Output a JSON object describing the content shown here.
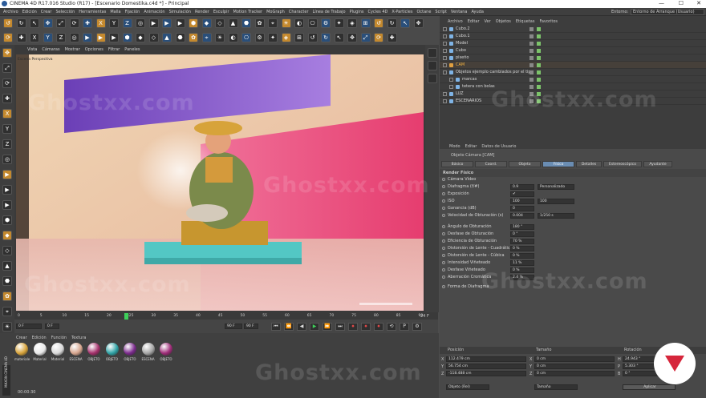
{
  "window": {
    "title": "CINEMA 4D R17.016 Studio (R17) - [Escenario Domestika.c4d *] - Principal",
    "controls": [
      "—",
      "☐",
      "✕"
    ]
  },
  "menu": {
    "items": [
      "Archivo",
      "Edición",
      "Crear",
      "Selección",
      "Herramientas",
      "Malla",
      "Fijación",
      "Animación",
      "Simulación",
      "Render",
      "Esculpir",
      "Motion Tracker",
      "MoGraph",
      "Character",
      "Línea de Trabajo",
      "Plugins",
      "Cycles 4D",
      "X-Particles",
      "Octane",
      "Script",
      "Ventana",
      "Ayuda"
    ],
    "layout_label": "Entorno:",
    "layout_value": "Entorno de Arranque (Usuario)"
  },
  "viewport": {
    "menu": [
      "Vista",
      "Cámaras",
      "Mostrar",
      "Opciones",
      "Filtrar",
      "Paneles"
    ],
    "caption": "Escena Perspectiva"
  },
  "objects": {
    "menu": [
      "Archivo",
      "Editar",
      "Ver",
      "Objetos",
      "Etiquetas",
      "Favoritos"
    ],
    "items": [
      {
        "name": "Cubo.2",
        "indent": 0
      },
      {
        "name": "Cubo.1",
        "indent": 0
      },
      {
        "name": "Model",
        "indent": 0
      },
      {
        "name": "Cubo",
        "indent": 0
      },
      {
        "name": "piseño",
        "indent": 0
      },
      {
        "name": "CAM",
        "indent": 0
      },
      {
        "name": "Objetos ejemplo cambiados por el tipo",
        "indent": 0
      },
      {
        "name": "marcas",
        "indent": 1
      },
      {
        "name": "tetera con bolas",
        "indent": 1
      },
      {
        "name": "LUZ",
        "indent": 0
      },
      {
        "name": "ESCENARIOS",
        "indent": 0
      }
    ]
  },
  "attributes": {
    "menu": [
      "Modo",
      "Editar",
      "Datos de Usuario"
    ],
    "object_title": "Objeto Cámara [CAM]",
    "tabs": [
      "Básico",
      "Coord.",
      "Objeto",
      "Físico",
      "Detalles",
      "Estereoscópico",
      "Ayudante"
    ],
    "active_tab": "Físico",
    "section": "Render Físico",
    "rows": [
      {
        "label": "Cámara Vídeo",
        "value": ""
      },
      {
        "label": "Diafragma (f/#)",
        "value": "0.9",
        "extra": "Personalizado"
      },
      {
        "label": "Exposición",
        "value": "✔"
      },
      {
        "label": "ISO",
        "value": "100",
        "extra": "100"
      },
      {
        "label": "Ganancia (dB)",
        "value": "0"
      },
      {
        "label": "Velocidad de Obturación (s)",
        "value": "0.004",
        "extra": "1/250 s"
      },
      {
        "label": "Ángulo de Obturación",
        "value": "180 °"
      },
      {
        "label": "Desfase de Obturación",
        "value": "0 °"
      },
      {
        "label": "Eficiencia de Obturación",
        "value": "70 %"
      },
      {
        "label": "Distorsión de Lente - Cuadrática",
        "value": "0 %"
      },
      {
        "label": "Distorsión de Lente - Cúbica",
        "value": "0 %"
      },
      {
        "label": "Intensidad Viñeteado",
        "value": "11 %"
      },
      {
        "label": "Desfase Viñeteado",
        "value": "0 %"
      },
      {
        "label": "Aberración Cromática",
        "value": "2.4 %"
      },
      {
        "label": "Forma de Diafragma",
        "value": ""
      }
    ]
  },
  "coords": {
    "headers": [
      "Posición",
      "Tamaño",
      "Rotación"
    ],
    "rows": [
      {
        "axis": "X",
        "pos": "112.479 cm",
        "size": "0 cm",
        "rot_axis": "H",
        "rot": "24.943 °"
      },
      {
        "axis": "Y",
        "pos": "56.754 cm",
        "size": "0 cm",
        "rot_axis": "P",
        "rot": "5.303 °"
      },
      {
        "axis": "Z",
        "pos": "-118.488 cm",
        "size": "0 cm",
        "rot_axis": "B",
        "rot": "0 °"
      }
    ],
    "mode": "Objeto (Rel)",
    "size_mode": "Tamaño",
    "apply": "Aplicar"
  },
  "timeline": {
    "ticks": [
      "0",
      "5",
      "10",
      "15",
      "20",
      "24",
      "25",
      "30",
      "35",
      "40",
      "45",
      "50",
      "55",
      "60",
      "65",
      "70",
      "75",
      "80",
      "85",
      "90"
    ],
    "start": "0 F",
    "current": "0 F",
    "end": "90 F",
    "end2": "90 F",
    "fps": "24 F"
  },
  "materials": {
    "menu": [
      "Crear",
      "Edición",
      "Función",
      "Textura"
    ],
    "items": [
      {
        "label": "materiale",
        "color": "#d7a33a"
      },
      {
        "label": "Material",
        "color": "#e8e8e8"
      },
      {
        "label": "Material",
        "color": "#d8d8d8"
      },
      {
        "label": "ESCENA",
        "color": "#d6a58e"
      },
      {
        "label": "OBJETO",
        "color": "#a4306b"
      },
      {
        "label": "OBJETO",
        "color": "#2fa3a6"
      },
      {
        "label": "OBJETO",
        "color": "#7a2a8c"
      },
      {
        "label": "ESCENA",
        "color": "#a5a5a5"
      },
      {
        "label": "OBJETO",
        "color": "#9e2c78"
      }
    ]
  },
  "status": {
    "time": "00:00:30"
  },
  "watermark": "Ghostxx.com",
  "brand": {
    "side": "MAXON CINEMA 4D"
  }
}
